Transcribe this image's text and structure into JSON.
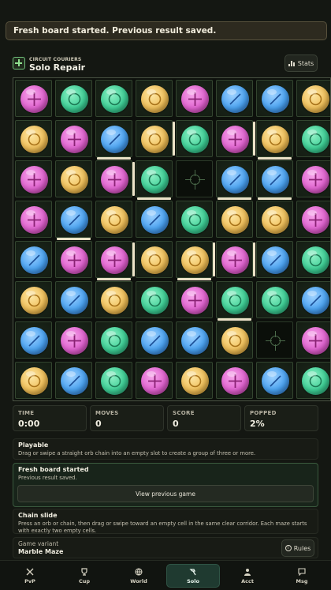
{
  "toast": {
    "message": "Fresh board started. Previous result saved."
  },
  "header": {
    "brand_small": "CIRCUIT COURIERS",
    "title": "Solo Repair",
    "stats_label": "Stats",
    "logo_icon": "circuit-cross-icon"
  },
  "colors": {
    "pink": "#e063cf",
    "green": "#3fcf96",
    "yellow": "#efbf5a",
    "blue": "#4aa2f0",
    "active_nav": "#1f3a30",
    "wall": "#ece3c8"
  },
  "board": {
    "cols": 8,
    "rows": 8,
    "legend": {
      "P": "pink-plus",
      "G": "green-ring",
      "Y": "yellow-ring",
      "B": "blue-slash",
      ".": "empty-slot"
    },
    "grid": [
      [
        "P",
        "G",
        "G",
        "Y",
        "P",
        "B",
        "B",
        "Y"
      ],
      [
        "Y",
        "P",
        "B",
        "Y",
        "G",
        "P",
        "Y",
        "G"
      ],
      [
        "P",
        "Y",
        "P",
        "G",
        ".",
        "B",
        "B",
        "P"
      ],
      [
        "P",
        "B",
        "Y",
        "B",
        "G",
        "Y",
        "Y",
        "P"
      ],
      [
        "B",
        "P",
        "P",
        "Y",
        "Y",
        "P",
        "B",
        "G"
      ],
      [
        "Y",
        "B",
        "Y",
        "G",
        "P",
        "G",
        "G",
        "B"
      ],
      [
        "B",
        "P",
        "G",
        "B",
        "B",
        "Y",
        ".",
        "P"
      ],
      [
        "Y",
        "B",
        "G",
        "P",
        "Y",
        "P",
        "B",
        "G"
      ]
    ]
  },
  "stats": [
    {
      "label": "TIME",
      "value": "0:00"
    },
    {
      "label": "MOVES",
      "value": "0"
    },
    {
      "label": "SCORE",
      "value": "0"
    },
    {
      "label": "POPPED",
      "value": "2%"
    }
  ],
  "playable": {
    "title": "Playable",
    "text": "Drag or swipe a straight orb chain into an empty slot to create a group of three or more."
  },
  "fresh": {
    "title": "Fresh board started",
    "text": "Previous result saved.",
    "button_label": "View previous game"
  },
  "chain": {
    "title": "Chain slide",
    "text": "Press an orb or chain, then drag or swipe toward an empty cell in the same clear corridor. Each maze starts with exactly two empty cells."
  },
  "variant": {
    "label": "Game variant",
    "value": "Marble Maze",
    "rules_label": "Rules"
  },
  "nav": {
    "items": [
      {
        "label": "PvP",
        "icon": "swords-icon"
      },
      {
        "label": "Cup",
        "icon": "trophy-icon"
      },
      {
        "label": "World",
        "icon": "globe-icon"
      },
      {
        "label": "Solo",
        "icon": "hammer-icon",
        "active": true
      },
      {
        "label": "Acct",
        "icon": "person-icon"
      },
      {
        "label": "Msg",
        "icon": "message-icon"
      }
    ]
  }
}
